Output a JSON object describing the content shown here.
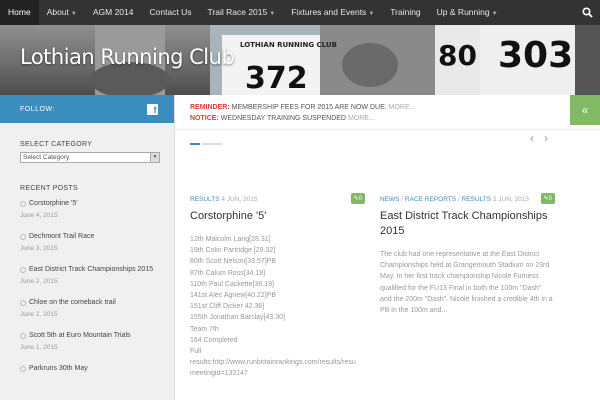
{
  "nav": {
    "items": [
      {
        "label": "Home",
        "active": true,
        "dropdown": false
      },
      {
        "label": "About",
        "dropdown": true
      },
      {
        "label": "AGM 2014",
        "dropdown": false
      },
      {
        "label": "Contact Us",
        "dropdown": false
      },
      {
        "label": "Trail Race 2015",
        "dropdown": true
      },
      {
        "label": "Fixtures and Events",
        "dropdown": true
      },
      {
        "label": "Training",
        "dropdown": false
      },
      {
        "label": "Up & Running",
        "dropdown": true
      }
    ],
    "search_icon": "search-icon"
  },
  "hero": {
    "site_title": "Lothian Running Club",
    "bib_texts": [
      "LOTHIAN RUNNING CLUB",
      "372",
      "80",
      "303"
    ]
  },
  "sidebar": {
    "follow_label": "FOLLOW:",
    "follow_icon": "facebook-icon",
    "category_title": "SELECT CATEGORY",
    "category_select_value": "Select Category",
    "recent_title": "RECENT POSTS",
    "recent_posts": [
      {
        "title": "Corstorphine '5'",
        "date": "June 4, 2015"
      },
      {
        "title": "Dechmont Trail Race",
        "date": "June 3, 2015"
      },
      {
        "title": "East District Track Championships 2015",
        "date": "June 2, 2015"
      },
      {
        "title": "Chloe on the comeback trail",
        "date": "June 2, 2015"
      },
      {
        "title": "Scott 5th at Euro Mountain Trials",
        "date": "June 1, 2015"
      },
      {
        "title": "Parkruns 30th May",
        "date": ""
      }
    ]
  },
  "notices": [
    {
      "label": "REMINDER:",
      "text": "MEMBERSHIP FEES FOR 2015 ARE NOW DUE.",
      "more": "MORE..."
    },
    {
      "label": "NOTICE:",
      "text": "WEDNESDAY TRAINING SUSPENDED",
      "more": "MORE..."
    }
  ],
  "posts": [
    {
      "categories": [
        "RESULTS"
      ],
      "date": "4 JUN, 2015",
      "comments": "0",
      "title": "Corstorphine '5'",
      "body_lines": [
        "12th Malcolm Lang[28.31]",
        "19th Colin Partridge [29.32]",
        "80th Scott Nelson[33.57]PB",
        "87th Calum Ross[34.18]",
        "110th Paul Cackette[36.19]",
        "141st Alec Agnew[40.22]PB",
        "151st Cliff Dicker 42.36]",
        "155th Jonathan Barclay[43.30]",
        "Team 7th",
        "164 Completed",
        "Full",
        "results:http://www.runbritainrankings.com/results/resu",
        "meetingid=133147"
      ]
    },
    {
      "categories": [
        "NEWS",
        "RACE REPORTS",
        "RESULTS"
      ],
      "date": "2 JUN, 2015",
      "comments": "0",
      "title": "East District Track Championships 2015",
      "body": "The club had one representative at the East District Championships held at Grangemouth Stadium on 23rd May. In her first track championship Nicole Furness qualified for the FU13 Final in both the 100m \"Dash\" and the 200m \"Dash\". Nicole finished a credible 4th in a PB in the 100m and..."
    }
  ],
  "colors": {
    "accent": "#3b8dbd",
    "green": "#82b965",
    "notice_red": "#e03a3a",
    "nav_bg": "#333333"
  }
}
